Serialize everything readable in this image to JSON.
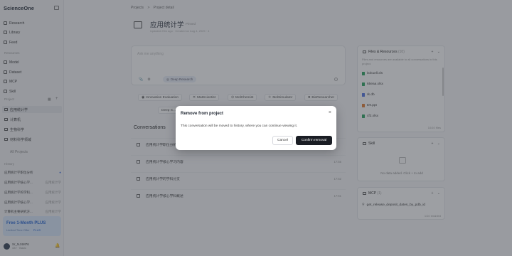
{
  "sidebar": {
    "logo": "ScienceOne",
    "nav": [
      {
        "label": "Research",
        "icon": "research-icon"
      },
      {
        "label": "Library",
        "icon": "library-icon"
      },
      {
        "label": "Feed",
        "icon": "feed-icon"
      }
    ],
    "resources_label": "Resources",
    "resources": [
      {
        "label": "Model",
        "icon": "model-icon"
      },
      {
        "label": "Dataset",
        "icon": "dataset-icon"
      },
      {
        "label": "MCP",
        "icon": "mcp-icon"
      },
      {
        "label": "Skill",
        "icon": "skill-icon"
      }
    ],
    "projects_label": "Project",
    "projects": [
      "应用统计学",
      "计算机",
      "生物科学",
      "材料科学领域"
    ],
    "all_projects": "All Projects",
    "history_label": "History",
    "history": [
      {
        "title": "应用统计学职位分析",
        "tag": ""
      },
      {
        "title": "应用统计学核心学...",
        "tag": "应用统计学"
      },
      {
        "title": "应用统计学的学科...",
        "tag": "应用统计学"
      },
      {
        "title": "应用统计学核心学...",
        "tag": "应用统计学"
      },
      {
        "title": "计算机主要研究方...",
        "tag": "应用统计学"
      }
    ],
    "promo": {
      "title": "Free 1-Month PLUS",
      "sub": "Limited Time Offer",
      "badge": "PLUS"
    },
    "user": {
      "name": "Sr_NJ4M76",
      "meta": "437 · Basic"
    }
  },
  "main": {
    "breadcrumb": {
      "root": "Projects",
      "sep": ">",
      "current": "Project detail"
    },
    "title": "应用统计学",
    "pinned": "Pinned",
    "meta": "Updated 29m ago · Created on Aug 4, 2025 · 4",
    "composer": {
      "placeholder": "Ask me anything",
      "deep_research": "Deep Research"
    },
    "agents": [
      "Innovation Evaluation",
      "MatScientist",
      "MolChemist",
      "MolSimulator",
      "BioResearcher",
      "Deep S..."
    ],
    "conversations_heading": "Conversations",
    "conversations": [
      {
        "title": "应用统计学职位分析",
        "time": ""
      },
      {
        "title": "应用统计学核心学习内容",
        "time": "17:55"
      },
      {
        "title": "应用统计学的学科分支",
        "time": "17:52"
      },
      {
        "title": "应用统计学核心学科概述",
        "time": "17:51"
      }
    ]
  },
  "right": {
    "files": {
      "title": "Files & Resources",
      "count": "(10)",
      "desc": "Files and resources are available to all conversations in this project.",
      "items": [
        {
          "name": "itokuell.xls",
          "color": "#22a05a"
        },
        {
          "name": "65eaa.xlsx",
          "color": "#22a05a"
        },
        {
          "name": "rk.db",
          "color": "#4a6ee0"
        },
        {
          "name": "E9.ppt",
          "color": "#e0782c"
        },
        {
          "name": "cf2.xlsx",
          "color": "#22a05a"
        }
      ],
      "footer": "10/10 files"
    },
    "skill": {
      "title": "Skill",
      "empty": "No data added. Click + to add"
    },
    "mcp": {
      "title": "MCP",
      "count": "(1)",
      "item": "get_release_deposit_dates_by_pdb_id",
      "footer": "1/10 enabled"
    }
  },
  "modal": {
    "title": "Remove from project",
    "body": "This conversation will be moved to history, where you can continue viewing it.",
    "cancel": "Cancel",
    "confirm": "Confirm removal"
  }
}
